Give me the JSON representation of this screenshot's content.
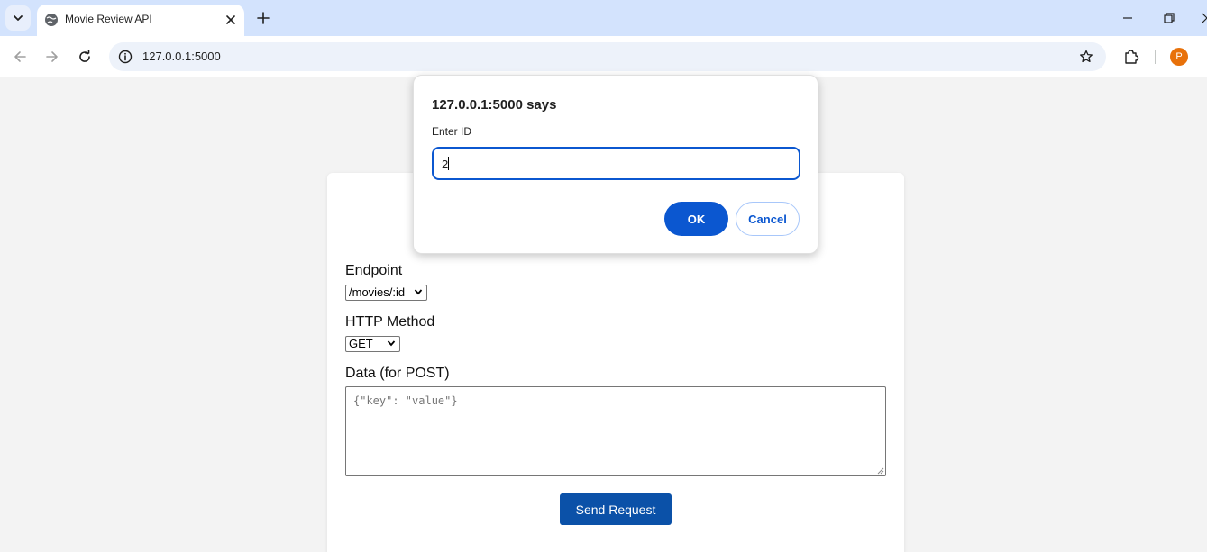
{
  "browser": {
    "tab": {
      "title": "Movie Review API"
    },
    "address": {
      "url": "127.0.0.1:5000"
    },
    "profile_initial": "P",
    "theme_color": "#d3e3fd"
  },
  "page": {
    "endpoint": {
      "label": "Endpoint",
      "selected": "/movies/:id"
    },
    "method": {
      "label": "HTTP Method",
      "selected": "GET"
    },
    "data": {
      "label": "Data (for POST)",
      "placeholder": "{\"key\": \"value\"}"
    },
    "send_label": "Send Request",
    "accent_color": "#0b51a8"
  },
  "dialog": {
    "title": "127.0.0.1:5000 says",
    "message": "Enter ID",
    "input_value": "2",
    "ok_label": "OK",
    "cancel_label": "Cancel",
    "accent_color": "#0b57d0"
  }
}
